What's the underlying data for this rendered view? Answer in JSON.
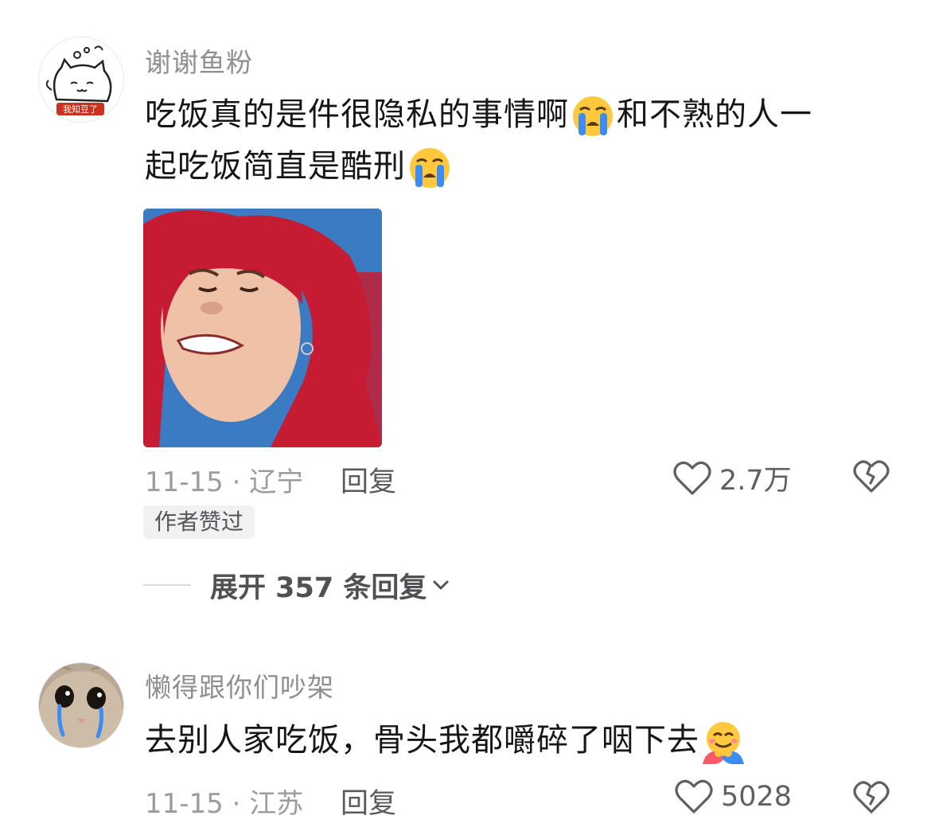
{
  "comments": [
    {
      "username": "谢谢鱼粉",
      "avatar_badge": "我知豆了",
      "text_line1_a": "吃饭真的是件很隐私的事情啊",
      "text_line1_b": "和不熟的人一",
      "text_line2": "起吃饭简直是酷刑",
      "emoji_1": "loudly-crying-face-icon",
      "emoji_2": "loudly-crying-face-icon",
      "has_image": true,
      "date_location": "11-15 · 辽宁",
      "reply_label": "回复",
      "likes": "2.7万",
      "author_badge": "作者赞过",
      "expand_label": "展开 357 条回复"
    },
    {
      "username": "懒得跟你们吵架",
      "text": "去别人家吃饭，骨头我都嚼碎了咽下去",
      "emoji": "hugging-face-icon",
      "date_location": "11-15 · 江苏",
      "reply_label": "回复",
      "likes": "5028"
    }
  ],
  "colors": {
    "username": "#8e8e93",
    "meta": "#9b9ba0",
    "emoji_yellow": "#ffc83d",
    "tear_blue": "#3d8cf0"
  }
}
